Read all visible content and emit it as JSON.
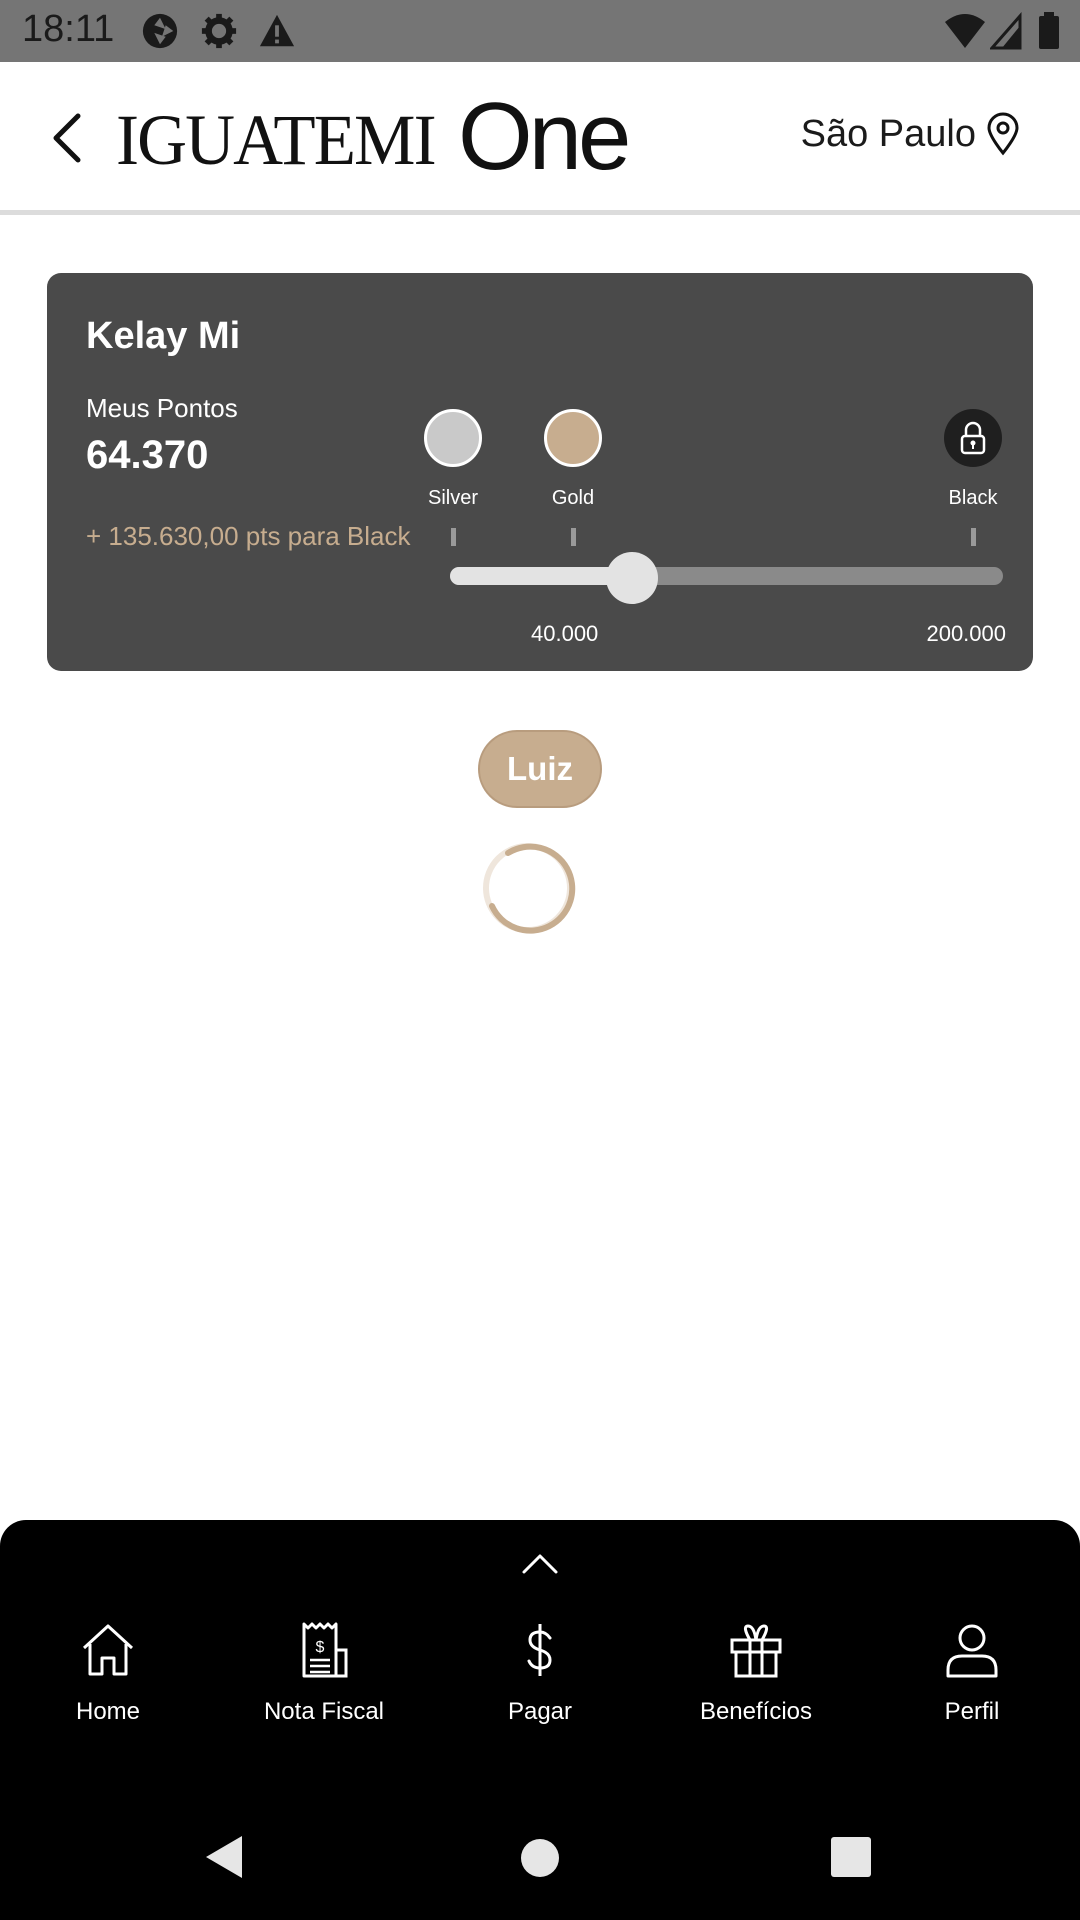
{
  "status_bar": {
    "time": "18:11",
    "left_icons": [
      "camera-aperture-icon",
      "settings-gear-icon",
      "warning-icon"
    ],
    "right_icons": [
      "wifi-icon",
      "signal-icon",
      "battery-icon"
    ]
  },
  "header": {
    "back_icon": "chevron-left-icon",
    "logo_main": "IGUATEMI",
    "logo_sub": "One",
    "city": "São Paulo",
    "city_icon": "location-pin-icon"
  },
  "card": {
    "name": "Kelay Mi",
    "points_label": "Meus Pontos",
    "points_value": "64.370",
    "points_needed": "+ 135.630,00 pts para Black",
    "tiers": [
      {
        "name": "Silver",
        "color": "#c9c9c9"
      },
      {
        "name": "Gold",
        "color": "#c7ad8f"
      },
      {
        "name": "Black",
        "color": "#1f1f1f",
        "icon": "lock-icon"
      }
    ],
    "progress_fraction": 0.33,
    "range_start": "40.000",
    "range_end": "200.000"
  },
  "chip": {
    "label": "Luiz"
  },
  "loading": {
    "icon": "loading-spinner-icon"
  },
  "bottom_nav": {
    "expand_icon": "chevron-up-icon",
    "items": [
      {
        "label": "Home",
        "icon": "home-icon"
      },
      {
        "label": "Nota Fiscal",
        "icon": "receipt-icon"
      },
      {
        "label": "Pagar",
        "icon": "dollar-icon"
      },
      {
        "label": "Benefícios",
        "icon": "gift-icon"
      },
      {
        "label": "Perfil",
        "icon": "user-icon"
      }
    ]
  },
  "colors": {
    "accent": "#c7ad8f",
    "card_bg": "#4a4a4a",
    "nav_bg": "#000000"
  }
}
